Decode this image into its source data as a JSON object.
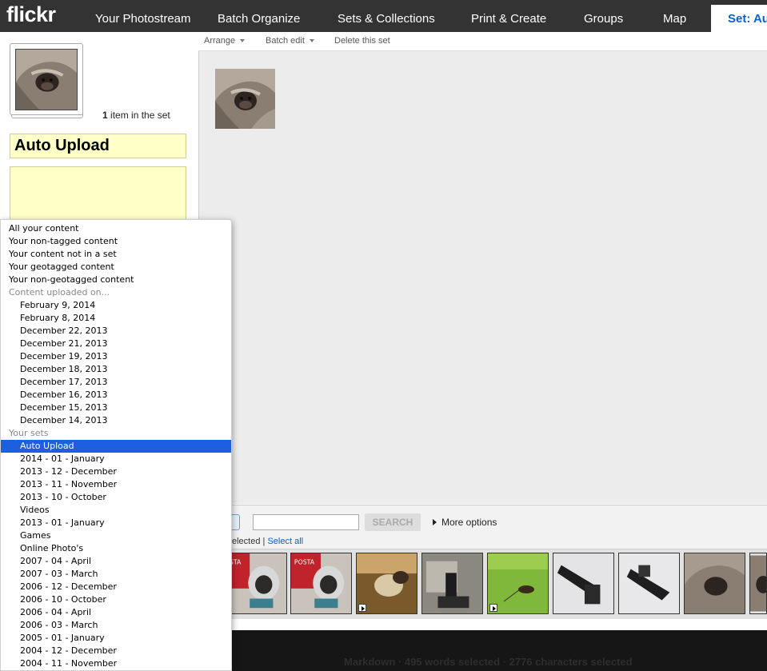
{
  "nav": {
    "logo": "flickr",
    "items": [
      "Your Photostream",
      "Batch Organize",
      "Sets & Collections",
      "Print & Create",
      "Groups",
      "Map"
    ],
    "active_tab": "Set: Au"
  },
  "toolbar": {
    "arrange": "Arrange",
    "batch_edit": "Batch edit",
    "delete": "Delete this set"
  },
  "set": {
    "count": "1",
    "count_suffix": " item in the set",
    "title": "Auto Upload",
    "description": ""
  },
  "search": {
    "button": "SEARCH",
    "more_options": "More options",
    "input_value": "",
    "selected_suffix": "elected",
    "select_all": "Select all"
  },
  "footer": {
    "status": "Markdown · 495 words selected · 2776 characters selected"
  },
  "menu": {
    "top_items": [
      "All your content",
      "Your non-tagged content",
      "Your content not in a set",
      "Your geotagged content",
      "Your non-geotagged content"
    ],
    "uploaded_header": "Content uploaded on...",
    "uploaded_dates": [
      "February 9, 2014",
      "February 8, 2014",
      "December 22, 2013",
      "December 21, 2013",
      "December 19, 2013",
      "December 18, 2013",
      "December 17, 2013",
      "December 16, 2013",
      "December 15, 2013",
      "December 14, 2013"
    ],
    "sets_header": "Your sets",
    "sets": [
      "Auto Upload",
      "2014 - 01 - January",
      "2013 - 12 - December",
      "2013 - 11 - November",
      "2013 - 10 - October",
      "Videos",
      "2013 - 01 - January",
      "Games",
      "Online Photo's",
      "2007 - 04 - April",
      "2007 - 03 - March",
      "2006 - 12 - December",
      "2006 - 10 - October",
      "2006 - 04 - April",
      "2006 - 03 - March",
      "2005 - 01 - January",
      "2004 - 12 - December",
      "2004 - 11 - November"
    ],
    "selected_set": "Auto Upload"
  },
  "colors": {
    "topbar": "#333333",
    "active_tab_text": "#0b62c4",
    "menu_selection": "#1d5fe0",
    "field_bg": "#ffffc8"
  }
}
